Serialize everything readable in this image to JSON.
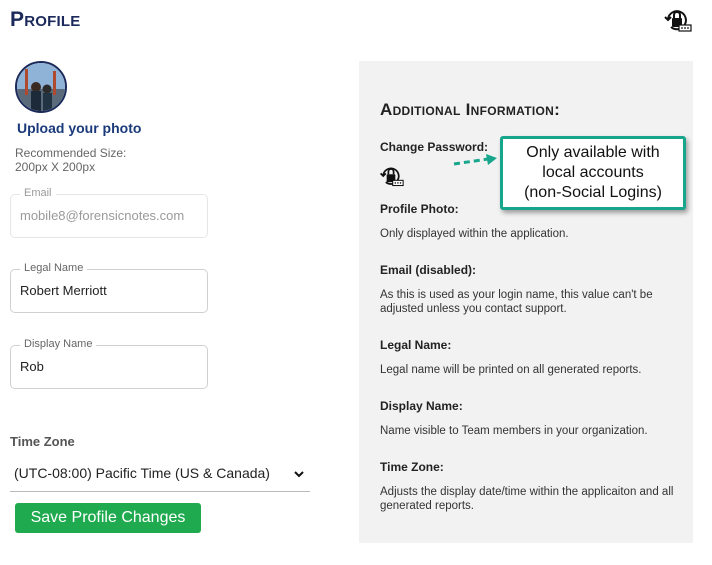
{
  "header": {
    "title": "Profile"
  },
  "profile_photo": {
    "upload_label": "Upload your photo",
    "recommended_label": "Recommended Size:",
    "recommended_size": "200px X 200px"
  },
  "fields": {
    "email": {
      "label": "Email",
      "value": "mobile8@forensicnotes.com",
      "disabled": true
    },
    "legal_name": {
      "label": "Legal Name",
      "value": "Robert Merriott"
    },
    "display_name": {
      "label": "Display Name",
      "value": "Rob"
    }
  },
  "timezone": {
    "label": "Time Zone",
    "selected": "(UTC-08:00) Pacific Time (US & Canada)"
  },
  "save_button": {
    "label": "Save Profile Changes"
  },
  "info_panel": {
    "title": "Additional Information:",
    "change_password": {
      "heading": "Change Password:"
    },
    "sections": [
      {
        "heading": "Profile Photo:",
        "text": "Only displayed within the application."
      },
      {
        "heading": "Email (disabled):",
        "text": "As this is used as your login name, this value can't be adjusted unless you contact support."
      },
      {
        "heading": "Legal Name:",
        "text": "Legal name will be printed on all generated reports."
      },
      {
        "heading": "Display Name:",
        "text": "Name visible to Team members in your organization."
      },
      {
        "heading": "Time Zone:",
        "text": "Adjusts the display date/time within the applicaiton and all generated reports."
      }
    ]
  },
  "callout": {
    "text": "Only available with\nlocal accounts\n(non-Social Logins)"
  },
  "colors": {
    "primary": "#1b2a5a",
    "save_green": "#1faa4f",
    "callout_border": "#17a68b",
    "panel_bg": "#f2f2f2"
  },
  "icons": {
    "top_right": "lock-reset-icon",
    "change_password": "lock-reset-icon",
    "timezone_dropdown": "chevron-down-icon"
  }
}
